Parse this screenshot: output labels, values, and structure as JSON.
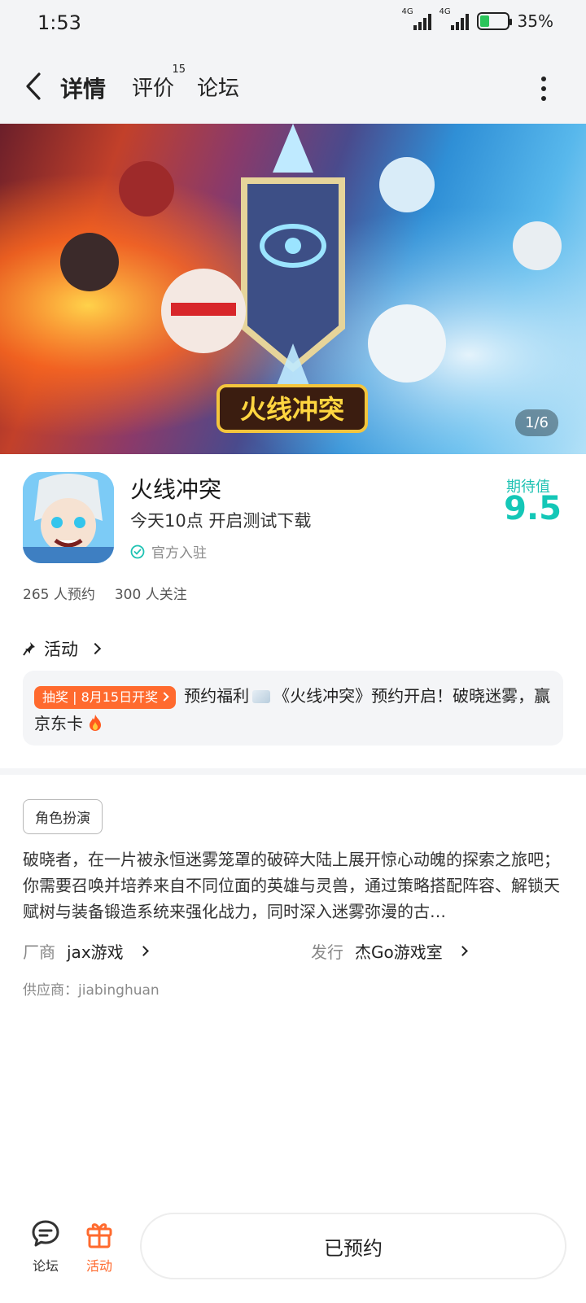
{
  "status_bar": {
    "time": "1:53",
    "signal1_label": "4G",
    "signal2_label": "4G",
    "battery_text": "35%",
    "battery_level": 0.35
  },
  "nav": {
    "tabs": [
      {
        "label": "详情",
        "active": true
      },
      {
        "label": "评价",
        "badge": "15"
      },
      {
        "label": "论坛"
      }
    ]
  },
  "banner": {
    "counter": "1/6",
    "logo_text": "火线冲突"
  },
  "app": {
    "title": "火线冲突",
    "subtitle": "今天10点 开启测试下载",
    "official_label": "官方入驻",
    "expect_label": "期待值",
    "expect_score": "9.5"
  },
  "stats": {
    "reservations": "265 人预约",
    "followers": "300 人关注"
  },
  "activity": {
    "header": "活动",
    "tag": "抽奖 | 8月15日开奖",
    "text_part1": "预约福利",
    "text_part2": "《火线冲突》预约开启！破晓迷雾，赢京东卡"
  },
  "details": {
    "genre": "角色扮演",
    "description": "破晓者，在一片被永恒迷雾笼罩的破碎大陆上展开惊心动魄的探索之旅吧；你需要召唤并培养来自不同位面的英雄与灵兽，通过策略搭配阵容、解锁天赋树与装备锻造系统来强化战力，同时深入迷雾弥漫的古…",
    "developer_key": "厂商",
    "developer_value": "jax游戏",
    "publisher_key": "发行",
    "publisher_value": "杰Go游戏室",
    "supplier": "供应商：jiabinghuan"
  },
  "bottom": {
    "forum_label": "论坛",
    "activity_label": "活动",
    "reserve_button": "已预约"
  },
  "colors": {
    "accent": "#14c7b7",
    "orange": "#ff6a2e"
  }
}
